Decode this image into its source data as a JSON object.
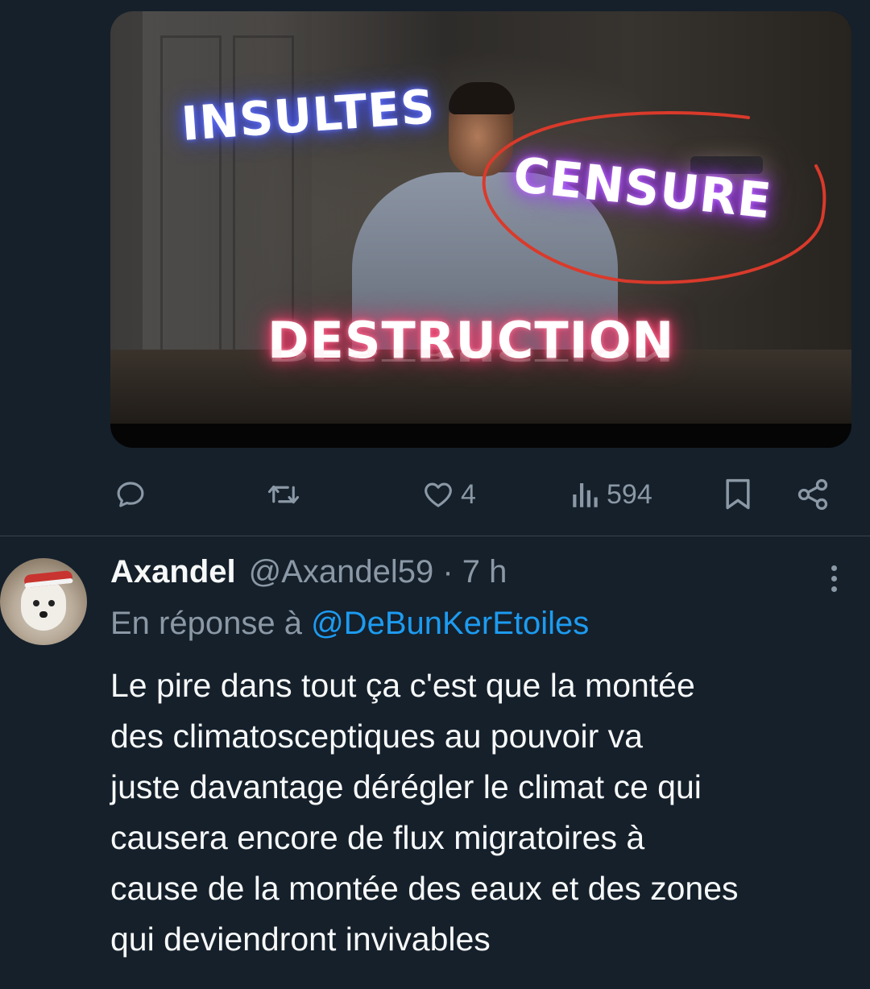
{
  "media": {
    "overlay_words": [
      "INSULTES",
      "CENSURE",
      "DESTRUCTION"
    ],
    "annotation_color": "#d93a2b"
  },
  "actions": {
    "reply_count": "",
    "retweet_count": "",
    "like_count": "4",
    "views_count": "594"
  },
  "reply": {
    "author_name": "Axandel",
    "author_handle": "@Axandel59 · 7 h",
    "replying_prefix": "En réponse à",
    "replying_to": "@DeBunKerEtoiles",
    "text_lines": [
      "Le pire dans tout ça c'est que la montée",
      "des climatosceptiques au pouvoir va",
      "juste davantage dérégler le climat ce qui",
      "causera encore de flux migratoires à",
      "cause de la montée des eaux et des zones",
      "qui deviendront invivables"
    ]
  },
  "colors": {
    "background": "#15202b",
    "secondary_text": "#8b98a5",
    "link": "#1d9bf0",
    "divider": "#38444d"
  }
}
